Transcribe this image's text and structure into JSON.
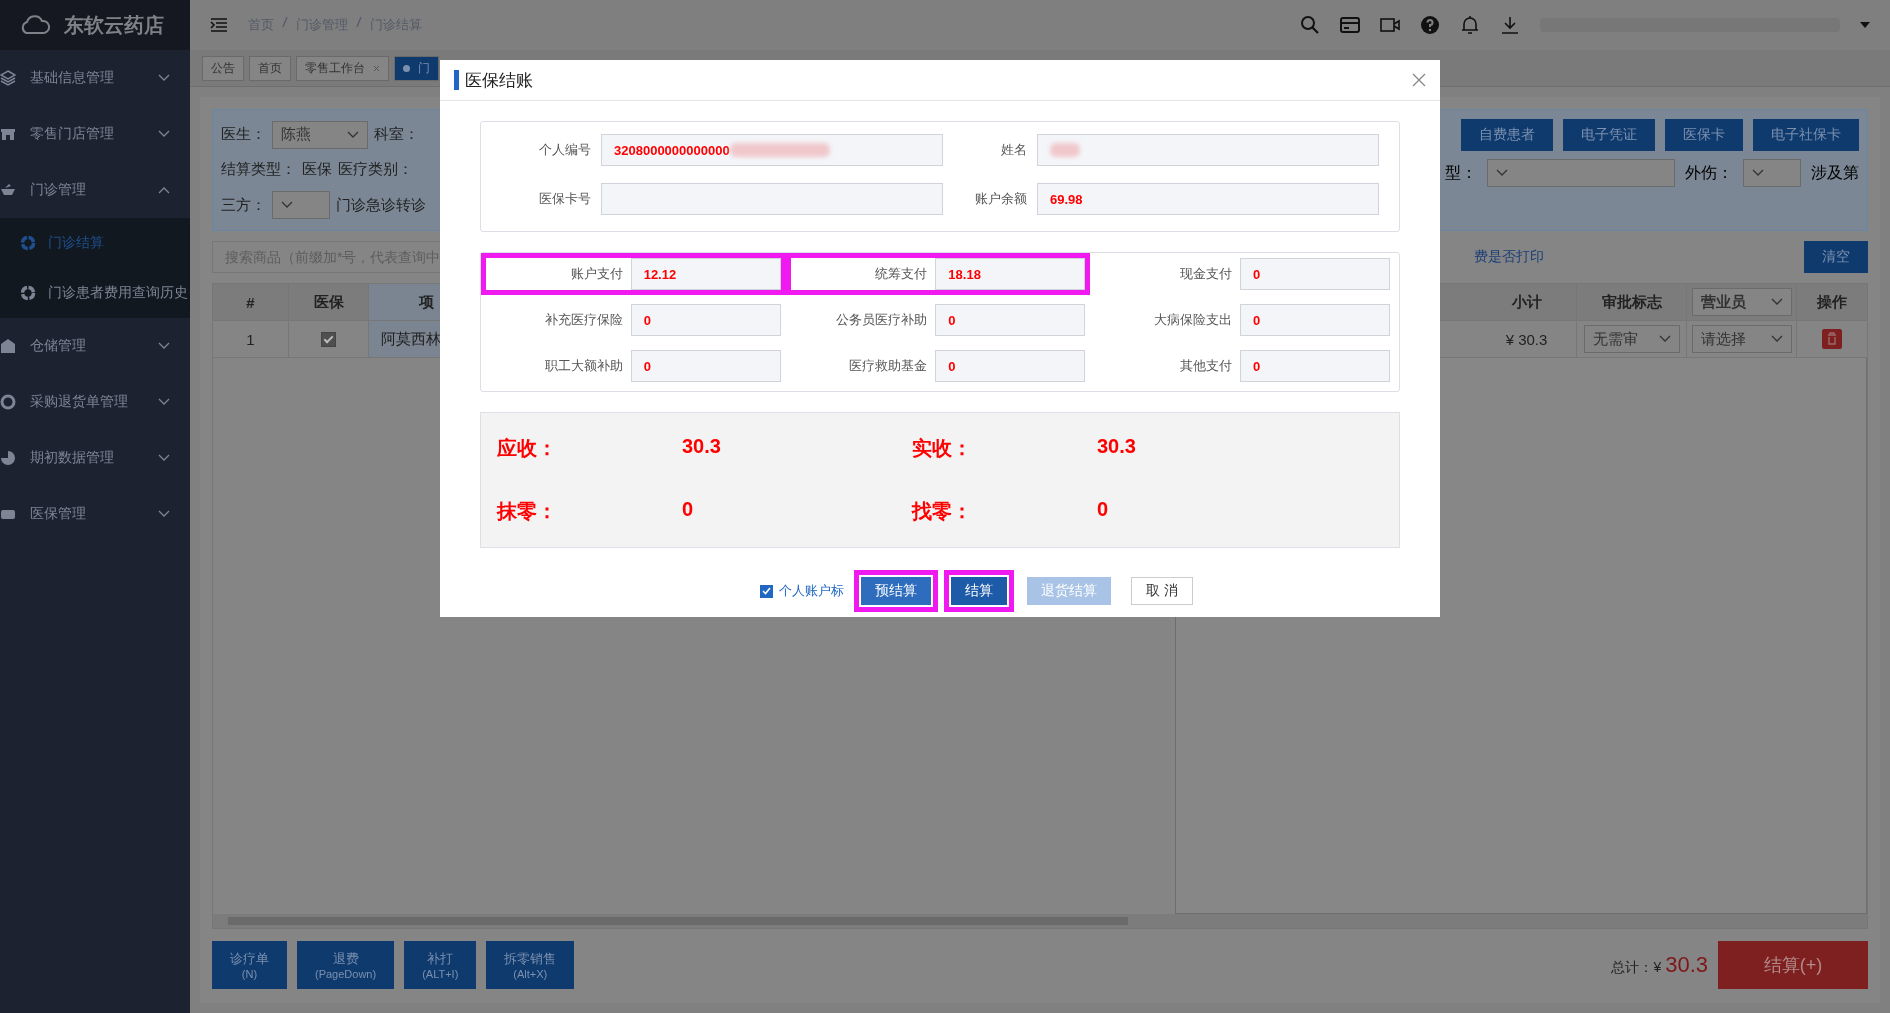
{
  "app": {
    "name": "东软云药店"
  },
  "sidebar": {
    "items": [
      {
        "label": "基础信息管理",
        "expanded": false
      },
      {
        "label": "零售门店管理",
        "expanded": false
      },
      {
        "label": "门诊管理",
        "expanded": true,
        "children": [
          {
            "label": "门诊结算",
            "selected": true
          },
          {
            "label": "门诊患者费用查询历史",
            "selected": false
          }
        ]
      },
      {
        "label": "仓储管理",
        "expanded": false
      },
      {
        "label": "采购退货单管理",
        "expanded": false
      },
      {
        "label": "期初数据管理",
        "expanded": false
      },
      {
        "label": "医保管理",
        "expanded": false
      }
    ]
  },
  "breadcrumb": [
    "首页",
    "门诊管理",
    "门诊结算"
  ],
  "tabs": [
    {
      "label": "公告",
      "selected": false,
      "closable": false
    },
    {
      "label": "首页",
      "selected": false,
      "closable": false
    },
    {
      "label": "零售工作台",
      "selected": false,
      "closable": true
    },
    {
      "label": "门",
      "selected": true,
      "closable": false
    }
  ],
  "filter": {
    "doctor_label": "医生：",
    "doctor_value": "陈燕",
    "dept_label": "科室：",
    "settle_label": "结算类型：",
    "settle_value": "医保",
    "category_label": "医疗类别：",
    "third_label": "三方：",
    "transfer_label": "门诊急诊转诊",
    "buttons": [
      "自费患者",
      "电子凭证",
      "医保卡",
      "电子社保卡"
    ],
    "type_label": "型：",
    "injury_label": "外伤：",
    "involve_label": "涉及第"
  },
  "search": {
    "placeholder": "搜索商品（前缀加*号，代表查询中"
  },
  "print_link": "费是否打印",
  "clear_button": "清空",
  "table": {
    "columns_left": [
      "#",
      "医保",
      "项"
    ],
    "columns_right": [
      "小计",
      "审批标志"
    ],
    "staff_select": "营业员",
    "action_column": "操作",
    "rows": [
      {
        "index": "1",
        "insured": true,
        "item": "阿莫西林",
        "subtotal": "¥ 30.3",
        "approval": "无需审",
        "staff": "请选择"
      }
    ]
  },
  "footer": {
    "buttons": [
      {
        "label": "诊疗单",
        "shortcut": "(N)"
      },
      {
        "label": "退费",
        "shortcut": "(PageDown)"
      },
      {
        "label": "补打",
        "shortcut": "(ALT+I)"
      },
      {
        "label": "拆零销售",
        "shortcut": "(Alt+X)"
      }
    ],
    "total_label": "总计：¥",
    "total_value": "30.3",
    "settle_button": "结算(+)"
  },
  "dialog": {
    "title": "医保结账",
    "info": [
      {
        "label": "个人编号",
        "value": "3208000000000000",
        "redacted": true
      },
      {
        "label": "姓名",
        "redacted": true
      },
      {
        "label": "医保卡号",
        "redacted": false
      },
      {
        "label": "账户余额",
        "value": "69.98",
        "redacted": false
      }
    ],
    "payments": [
      {
        "label": "账户支付",
        "value": "12.12",
        "highlighted": true
      },
      {
        "label": "统筹支付",
        "value": "18.18",
        "highlighted": true
      },
      {
        "label": "现金支付",
        "value": "0",
        "highlighted": false
      },
      {
        "label": "补充医疗保险",
        "value": "0",
        "highlighted": false
      },
      {
        "label": "公务员医疗补助",
        "value": "0",
        "highlighted": false
      },
      {
        "label": "大病保险支出",
        "value": "0",
        "highlighted": false
      },
      {
        "label": "职工大额补助",
        "value": "0",
        "highlighted": false
      },
      {
        "label": "医疗救助基金",
        "value": "0",
        "highlighted": false
      },
      {
        "label": "其他支付",
        "value": "0",
        "highlighted": false
      }
    ],
    "summary": [
      {
        "label": "应收：",
        "value": "30.3"
      },
      {
        "label": "实收：",
        "value": "30.3"
      },
      {
        "label": "抹零：",
        "value": "0"
      },
      {
        "label": "找零：",
        "value": "0"
      }
    ],
    "account_flag": {
      "label": "个人账户标",
      "checked": true
    },
    "buttons": [
      {
        "label": "预结算",
        "kind": "primary",
        "highlighted": true
      },
      {
        "label": "结算",
        "kind": "dark",
        "highlighted": true
      },
      {
        "label": "退货结算",
        "kind": "disabled",
        "highlighted": false
      },
      {
        "label": "取 消",
        "kind": "plain",
        "highlighted": false
      }
    ]
  }
}
